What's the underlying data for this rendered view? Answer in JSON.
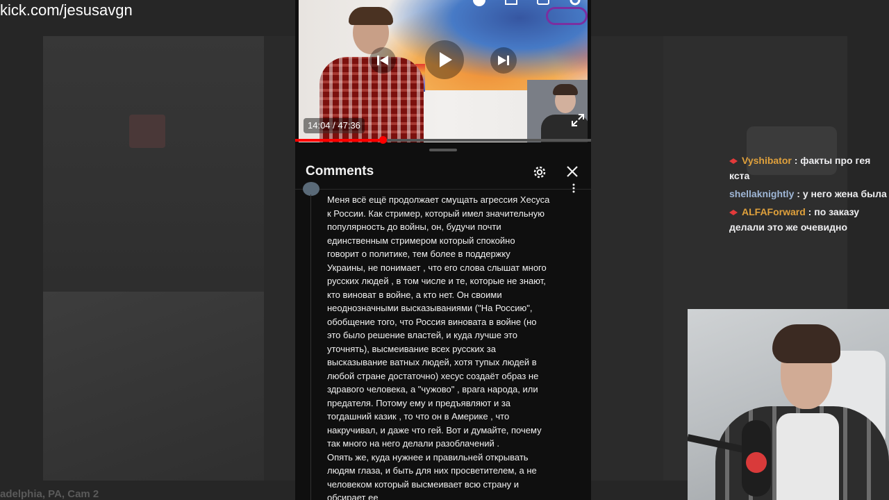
{
  "stream": {
    "url": "kick.com/jesusavgn",
    "background_caption": "adelphia, PA, Cam 2"
  },
  "video": {
    "time": "14:04 / 47:36",
    "progress_fraction": 0.295
  },
  "comments_panel": {
    "title": "Comments",
    "comment_text": "Меня всё ещё продолжает смущать агрессия Хесуса\nк России. Как стример, который имел значительную\nпопулярность до войны, он, будучи  почти\nединственным стримером который спокойно\nговорит о политике, тем более в поддержку\nУкраины, не понимает , что его слова слышат много\nрусских людей , в том числе и те, которые не знают,\nкто виноват в войне, а кто нет. Он своими\nнеоднозначными высказываниями (\"На Россию\",\nобобщение того, что Россия виновата в войне (но\nэто было решение властей, и куда лучше это\nуточнять), высмеивание всех русских за\nвысказывание ватных людей, хотя тупых людей в\nлюбой стране достаточно) хесус создаёт образ не\nздравого человека, а \"чужово\" , врага народа, или\nпредателя. Потому ему и предъявляют и за\nтогдашний казик , то что он в Америке , что\nнакручивал, и даже что гей. Вот и думайте, почему\nтак много на него делали разоблачений .\nОпять же, куда нужнее и правильней открывать\nлюдям глаза, и быть для них просветителем, а не\nчеловеком который высмеивает всю страну и\nобсирает ее"
  },
  "chat": {
    "messages": [
      {
        "user": "Vyshibator",
        "user_color": "#e0a13c",
        "text": "факты про гея кста",
        "badge": true
      },
      {
        "user": "shellaknightly",
        "user_color": "#9fb6d6",
        "text": "у него жена была",
        "badge": false
      },
      {
        "user": "ALFAForward",
        "user_color": "#e0a13c",
        "text": "по заказу делали это же очевидно",
        "badge": true
      }
    ]
  },
  "colors": {
    "youtube_red": "#ff0000",
    "panel_bg": "#0f0f0f"
  }
}
